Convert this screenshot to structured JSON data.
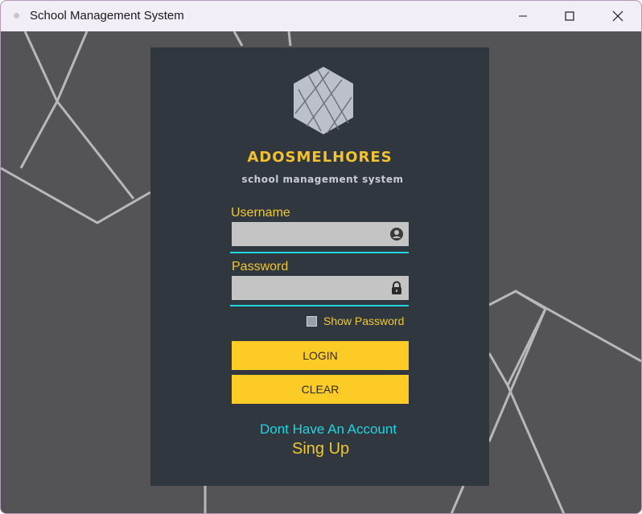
{
  "window": {
    "title": "School Management System",
    "controls": [
      "minimize-icon",
      "maximize-icon",
      "close-icon"
    ]
  },
  "brand": {
    "name": "ADOSMELHORES",
    "subtitle": "school management system",
    "logo_icon": "hexagon-logo-icon"
  },
  "form": {
    "username_label": "Username",
    "username_value": "",
    "username_icon": "user-circle-icon",
    "password_label": "Password",
    "password_value": "",
    "password_icon": "lock-icon",
    "show_password_label": "Show Password",
    "show_password_checked": false
  },
  "buttons": {
    "login": "LOGIN",
    "clear": "CLEAR"
  },
  "footer": {
    "no_account_text": "Dont Have An Account",
    "signup_link": "Sing Up"
  },
  "colors": {
    "panel": "#31373e",
    "background": "#545457",
    "accent_yellow": "#fdcb25",
    "label_yellow": "#f0c832",
    "cyan": "#22d3e0",
    "field": "#c4c4c4"
  }
}
